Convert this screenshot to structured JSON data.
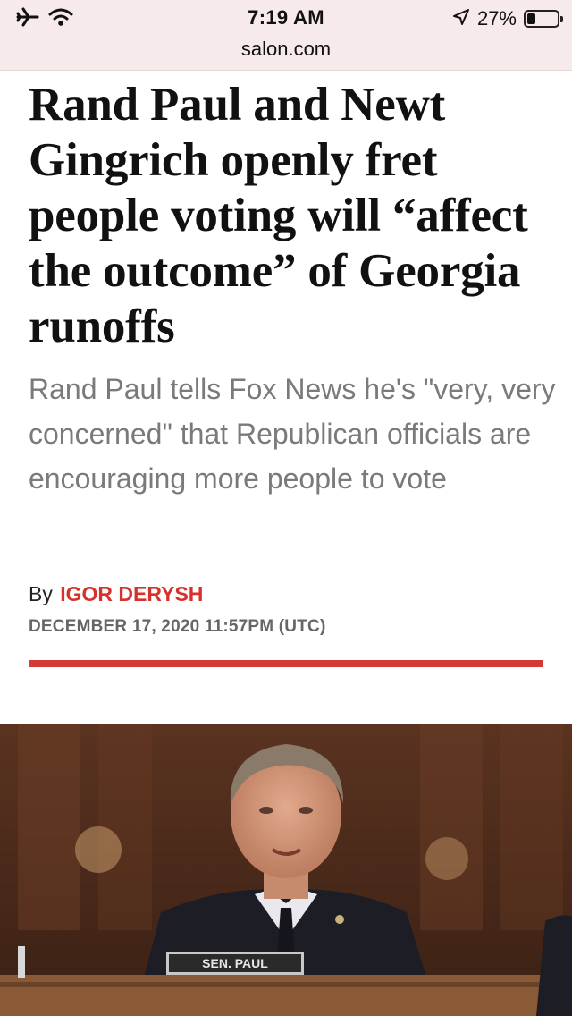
{
  "status_bar": {
    "time": "7:19 AM",
    "battery_percent": "27%",
    "battery_level": 0.27,
    "url": "salon.com",
    "icons": [
      "airplane-icon",
      "wifi-icon",
      "location-arrow-icon",
      "battery-icon"
    ]
  },
  "article": {
    "headline": "Rand Paul and Newt Gingrich openly fret people voting will “affect the outcome” of Georgia runoffs",
    "dek": "Rand Paul tells Fox News he's \"very, very concerned\" that Republican officials are encouraging more people to vote",
    "byline_prefix": "By",
    "author": "IGOR DERYSH",
    "date": "DECEMBER 17, 2020 11:57PM (UTC)"
  },
  "hero_image": {
    "nameplate": "SEN. PAUL"
  },
  "colors": {
    "accent": "#d6312b",
    "status_bar_bg": "#f6eaea",
    "dek_text": "#7a7a7a"
  }
}
